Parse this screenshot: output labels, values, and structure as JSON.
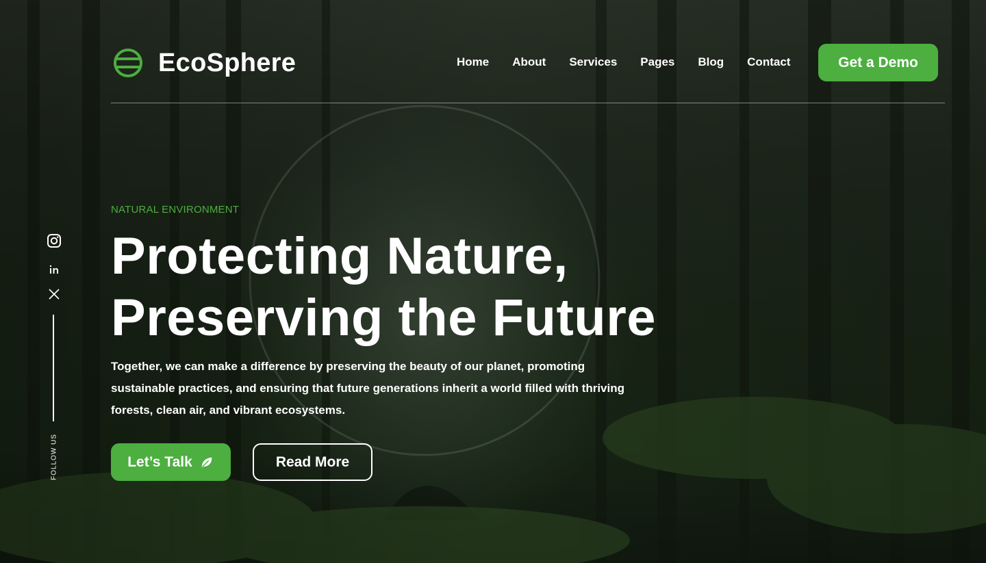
{
  "header": {
    "brand": "EcoSphere",
    "nav": [
      "Home",
      "About",
      "Services",
      "Pages",
      "Blog",
      "Contact"
    ],
    "cta_label": "Get a Demo"
  },
  "social": {
    "icons": [
      "instagram-icon",
      "linkedin-icon",
      "x-icon"
    ],
    "follow_label": "FOLLOW US"
  },
  "hero": {
    "eyebrow": "NATURAL ENVIRONMENT",
    "title_line1": "Protecting Nature,",
    "title_line2": "Preserving the Future",
    "description": "Together, we can make a difference by preserving the beauty of our planet, promoting sustainable practices, and ensuring that future generations inherit a world filled with thriving forests, clean air, and vibrant ecosystems.",
    "primary_button": "Let’s Talk",
    "secondary_button": "Read More"
  },
  "colors": {
    "accent": "#4caf3f",
    "text": "#ffffff",
    "background": "#1d2a1a"
  }
}
